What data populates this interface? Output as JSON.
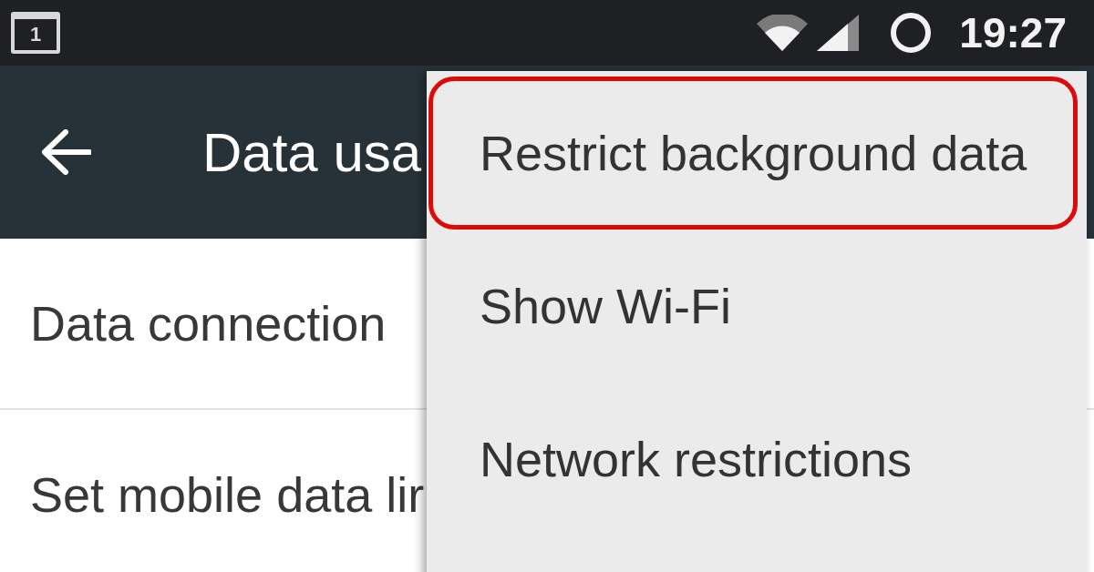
{
  "status_bar": {
    "notification_icon_label": "1",
    "time": "19:27"
  },
  "toolbar": {
    "title": "Data usa"
  },
  "settings": [
    {
      "label": "Data connection"
    },
    {
      "label": "Set mobile data lir"
    }
  ],
  "overflow_menu": {
    "items": [
      {
        "label": "Restrict background data",
        "highlighted": true
      },
      {
        "label": "Show Wi-Fi",
        "highlighted": false
      },
      {
        "label": "Network restrictions",
        "highlighted": false
      }
    ]
  }
}
